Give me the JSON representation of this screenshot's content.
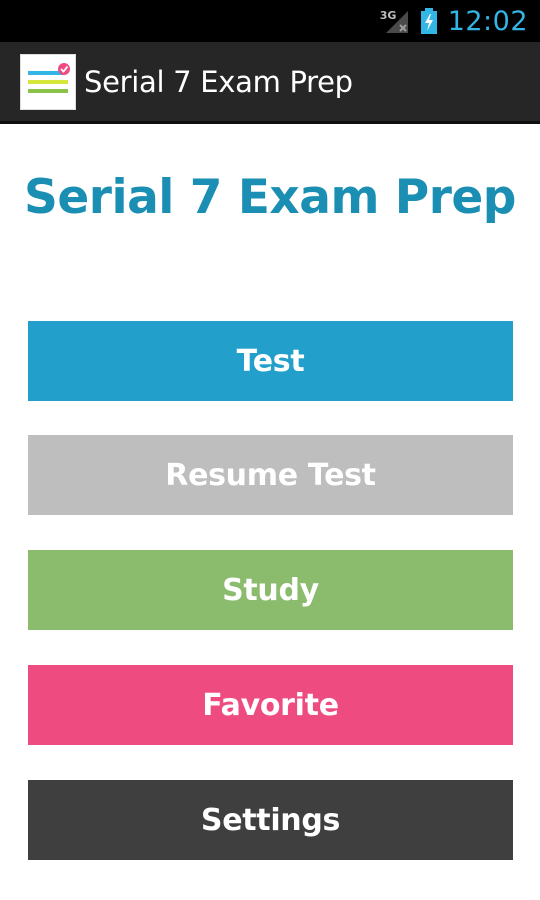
{
  "status_bar": {
    "network_label": "3G",
    "clock": "12:02",
    "clock_color": "#33b5e5"
  },
  "action_bar": {
    "title": "Serial 7 Exam Prep"
  },
  "main": {
    "title": "Serial 7 Exam Prep",
    "title_color": "#1a8fb3",
    "buttons": [
      {
        "label": "Test",
        "color": "#22a0cb"
      },
      {
        "label": "Resume Test",
        "color": "#bebebe"
      },
      {
        "label": "Study",
        "color": "#8bbb6c"
      },
      {
        "label": "Favorite",
        "color": "#ee4b80"
      },
      {
        "label": "Settings",
        "color": "#3f3f3f"
      }
    ]
  },
  "icons": {
    "app": "checklist-app-icon",
    "signal": "cell-signal-icon",
    "battery": "battery-charging-icon"
  }
}
